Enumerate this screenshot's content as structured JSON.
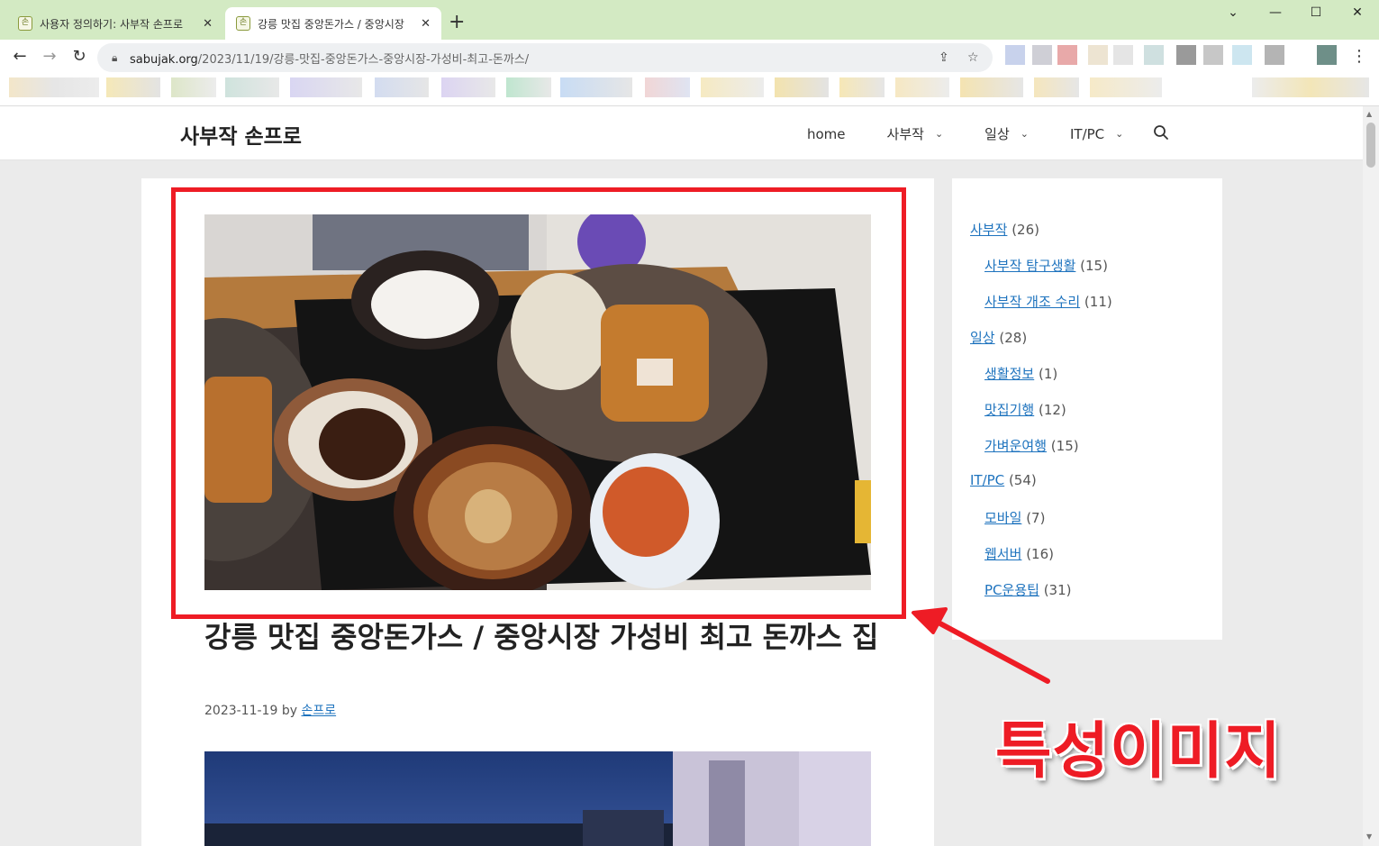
{
  "browser": {
    "tabs": [
      {
        "title": "사용자 정의하기: 사부작 손프로",
        "favicon": "손",
        "active": false
      },
      {
        "title": "강릉 맛집 중앙돈가스 / 중앙시장",
        "favicon": "손",
        "active": true
      }
    ],
    "url_host": "sabujak.org",
    "url_path": "/2023/11/19/강릉-맛집-중앙돈가스-중앙시장-가성비-최고-돈까스/"
  },
  "site": {
    "title": "사부작 손프로",
    "nav": [
      {
        "label": "home",
        "has_dropdown": false
      },
      {
        "label": "사부작",
        "has_dropdown": true
      },
      {
        "label": "일상",
        "has_dropdown": true
      },
      {
        "label": "IT/PC",
        "has_dropdown": true
      }
    ]
  },
  "post": {
    "title": "강릉 맛집 중앙돈가스 / 중앙시장 가성비 최고 돈까스 집",
    "date": "2023-11-19",
    "by": "by",
    "author": "손프로"
  },
  "sidebar": {
    "categories": [
      {
        "label": "사부작",
        "count": "(26)",
        "level": 0
      },
      {
        "label": "사부작 탐구생활",
        "count": "(15)",
        "level": 1
      },
      {
        "label": "사부작 개조 수리",
        "count": "(11)",
        "level": 1
      },
      {
        "label": "일상",
        "count": "(28)",
        "level": 0
      },
      {
        "label": "생활정보",
        "count": "(1)",
        "level": 1
      },
      {
        "label": "맛집기행",
        "count": "(12)",
        "level": 1
      },
      {
        "label": "가벼운여행",
        "count": "(15)",
        "level": 1
      },
      {
        "label": "IT/PC",
        "count": "(54)",
        "level": 0
      },
      {
        "label": "모바일",
        "count": "(7)",
        "level": 1
      },
      {
        "label": "웹서버",
        "count": "(16)",
        "level": 1
      },
      {
        "label": "PC운용팁",
        "count": "(31)",
        "level": 1
      }
    ]
  },
  "annotation": {
    "label": "특성이미지",
    "color": "#ee1c25"
  },
  "colors": {
    "tabstrip": "#d3eac3",
    "link": "#1e73be"
  }
}
